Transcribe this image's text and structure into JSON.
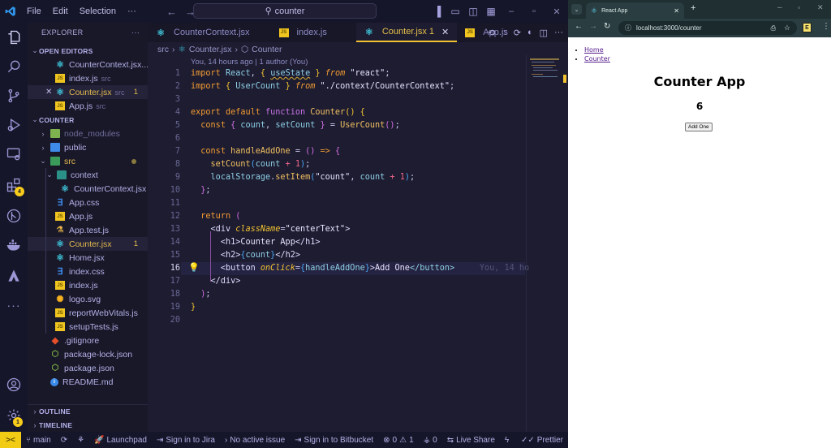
{
  "vscode": {
    "menu": [
      "File",
      "Edit",
      "Selection",
      "···"
    ],
    "search_text": "counter",
    "explorer_title": "EXPLORER",
    "open_editors_label": "OPEN EDITORS",
    "open_editors": [
      {
        "name": "CounterContext.jsx...",
        "icon": "react",
        "path": ""
      },
      {
        "name": "index.js",
        "icon": "js",
        "path": "src"
      },
      {
        "name": "Counter.jsx",
        "icon": "react",
        "path": "src",
        "problems": "1",
        "modified": true
      },
      {
        "name": "App.js",
        "icon": "js",
        "path": "src"
      }
    ],
    "project_label": "COUNTER",
    "tree": [
      {
        "name": "node_modules",
        "icon": "folder"
      },
      {
        "name": "public",
        "icon": "fpub"
      },
      {
        "name": "src",
        "icon": "fsrc"
      },
      {
        "name": "context",
        "icon": "fctx"
      },
      {
        "name": "CounterContext.jsx",
        "icon": "react"
      },
      {
        "name": "App.css",
        "icon": "css"
      },
      {
        "name": "App.js",
        "icon": "js"
      },
      {
        "name": "App.test.js",
        "icon": "test"
      },
      {
        "name": "Counter.jsx",
        "icon": "react",
        "problems": "1"
      },
      {
        "name": "Home.jsx",
        "icon": "react"
      },
      {
        "name": "index.css",
        "icon": "css"
      },
      {
        "name": "index.js",
        "icon": "js"
      },
      {
        "name": "logo.svg",
        "icon": "svg"
      },
      {
        "name": "reportWebVitals.js",
        "icon": "js"
      },
      {
        "name": "setupTests.js",
        "icon": "js"
      },
      {
        "name": ".gitignore",
        "icon": "git"
      },
      {
        "name": "package-lock.json",
        "icon": "json"
      },
      {
        "name": "package.json",
        "icon": "json"
      },
      {
        "name": "README.md",
        "icon": "info"
      }
    ],
    "outline_label": "OUTLINE",
    "timeline_label": "TIMELINE",
    "extensions_badge": "4",
    "settings_badge": "1",
    "tabs": [
      {
        "name": "CounterContext.jsx",
        "icon": "react"
      },
      {
        "name": "index.js",
        "icon": "js"
      },
      {
        "name": "Counter.jsx 1",
        "icon": "react",
        "active": true
      },
      {
        "name": "App.js",
        "icon": "js"
      }
    ],
    "breadcrumb": [
      "src",
      "Counter.jsx",
      "Counter"
    ],
    "blame": "You, 14 hours ago | 1 author (You)",
    "inline_blame": "You, 14 ho",
    "current_line": 16,
    "line_count": 20,
    "status": {
      "branch": "main",
      "launchpad": "Launchpad",
      "jira": "Sign in to Jira",
      "issue": "No active issue",
      "bitbucket": "Sign in to Bitbucket",
      "errors": "0",
      "warnings": "1",
      "ports": "0",
      "liveshare": "Live Share",
      "prettier": "Prettier"
    }
  },
  "browser": {
    "tab_title": "React App",
    "url": "localhost:3000/counter",
    "nav_links": [
      "Home",
      "Counter"
    ],
    "heading": "Counter App",
    "count": "6",
    "button_label": "Add One"
  }
}
